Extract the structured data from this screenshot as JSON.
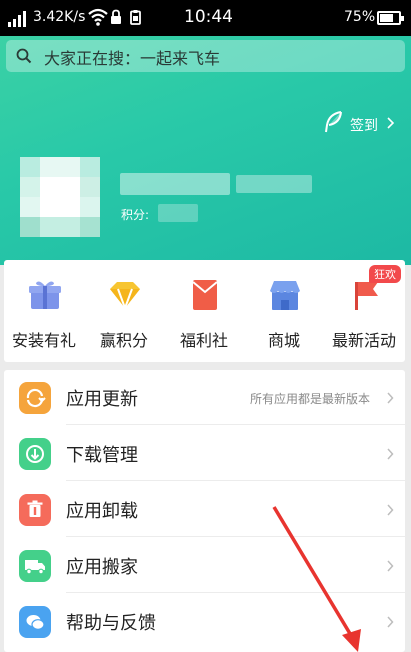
{
  "status_bar": {
    "network_speed": "3.42K/s",
    "time": "10:44",
    "battery_percent": "75%",
    "battery_level": 0.75,
    "icons": [
      "signal-icon",
      "wifi-icon",
      "lock-icon",
      "clipboard-icon",
      "battery-icon"
    ]
  },
  "search": {
    "icon": "search-icon",
    "text": "大家正在搜：一起来飞车"
  },
  "checkin": {
    "icon": "feather-icon",
    "label": "签到"
  },
  "profile": {
    "points_label": "积分:"
  },
  "quick_actions": {
    "hot_badge": "狂欢",
    "items": [
      {
        "label": "安装有礼",
        "icon": "gift-icon",
        "color": "#7d94ea"
      },
      {
        "label": "赢积分",
        "icon": "diamond-icon",
        "color": "#f7c531"
      },
      {
        "label": "福利社",
        "icon": "red-envelope-icon",
        "color": "#f05d47"
      },
      {
        "label": "商城",
        "icon": "store-icon",
        "color": "#5b86e0"
      },
      {
        "label": "最新活动",
        "icon": "flag-icon",
        "color": "#f05a4c"
      }
    ]
  },
  "menu": {
    "items": [
      {
        "label": "应用更新",
        "icon": "refresh-icon",
        "color": "#f5a43c",
        "status": "所有应用都是最新版本"
      },
      {
        "label": "下载管理",
        "icon": "download-icon",
        "color": "#44d08a",
        "status": ""
      },
      {
        "label": "应用卸载",
        "icon": "trash-icon",
        "color": "#f56b5b",
        "status": ""
      },
      {
        "label": "应用搬家",
        "icon": "truck-icon",
        "color": "#44d08a",
        "status": ""
      },
      {
        "label": "帮助与反馈",
        "icon": "chat-icon",
        "color": "#4aa3f0",
        "status": ""
      }
    ]
  },
  "colors": {
    "hero_top": "#3fd3a4",
    "hero_bottom": "#1db9a4",
    "annotation_arrow": "#e8342f"
  }
}
